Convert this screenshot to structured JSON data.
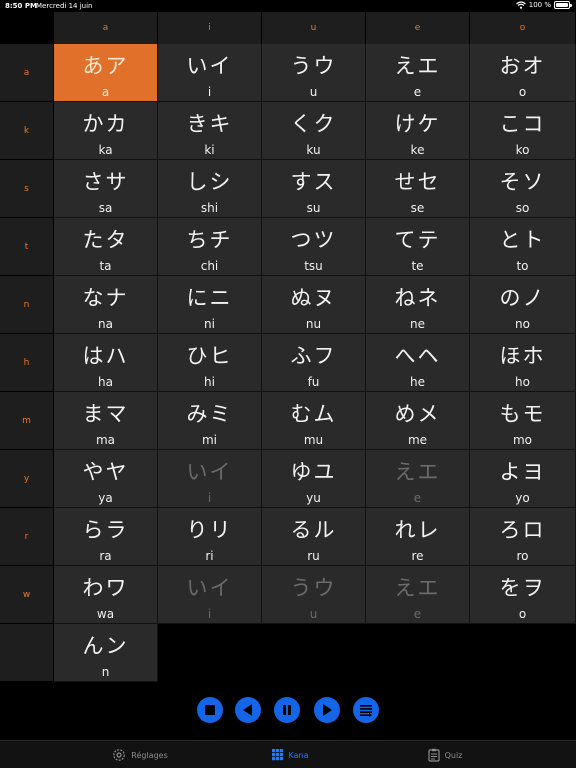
{
  "status": {
    "time": "8:50 PM",
    "date": "Mercredi 14 juin",
    "battery": "100 %"
  },
  "columns": [
    "a",
    "i",
    "u",
    "e",
    "o"
  ],
  "rows": [
    {
      "label": "a",
      "cells": [
        {
          "kana": "あア",
          "romaji": "a",
          "selected": true
        },
        {
          "kana": "いイ",
          "romaji": "i"
        },
        {
          "kana": "うウ",
          "romaji": "u"
        },
        {
          "kana": "えエ",
          "romaji": "e"
        },
        {
          "kana": "おオ",
          "romaji": "o"
        }
      ]
    },
    {
      "label": "k",
      "cells": [
        {
          "kana": "かカ",
          "romaji": "ka"
        },
        {
          "kana": "きキ",
          "romaji": "ki"
        },
        {
          "kana": "くク",
          "romaji": "ku"
        },
        {
          "kana": "けケ",
          "romaji": "ke"
        },
        {
          "kana": "こコ",
          "romaji": "ko"
        }
      ]
    },
    {
      "label": "s",
      "cells": [
        {
          "kana": "さサ",
          "romaji": "sa"
        },
        {
          "kana": "しシ",
          "romaji": "shi"
        },
        {
          "kana": "すス",
          "romaji": "su"
        },
        {
          "kana": "せセ",
          "romaji": "se"
        },
        {
          "kana": "そソ",
          "romaji": "so"
        }
      ]
    },
    {
      "label": "t",
      "cells": [
        {
          "kana": "たタ",
          "romaji": "ta"
        },
        {
          "kana": "ちチ",
          "romaji": "chi"
        },
        {
          "kana": "つツ",
          "romaji": "tsu"
        },
        {
          "kana": "てテ",
          "romaji": "te"
        },
        {
          "kana": "とト",
          "romaji": "to"
        }
      ]
    },
    {
      "label": "n",
      "cells": [
        {
          "kana": "なナ",
          "romaji": "na"
        },
        {
          "kana": "にニ",
          "romaji": "ni"
        },
        {
          "kana": "ぬヌ",
          "romaji": "nu"
        },
        {
          "kana": "ねネ",
          "romaji": "ne"
        },
        {
          "kana": "のノ",
          "romaji": "no"
        }
      ]
    },
    {
      "label": "h",
      "cells": [
        {
          "kana": "はハ",
          "romaji": "ha"
        },
        {
          "kana": "ひヒ",
          "romaji": "hi"
        },
        {
          "kana": "ふフ",
          "romaji": "fu"
        },
        {
          "kana": "へヘ",
          "romaji": "he"
        },
        {
          "kana": "ほホ",
          "romaji": "ho"
        }
      ]
    },
    {
      "label": "m",
      "cells": [
        {
          "kana": "まマ",
          "romaji": "ma"
        },
        {
          "kana": "みミ",
          "romaji": "mi"
        },
        {
          "kana": "むム",
          "romaji": "mu"
        },
        {
          "kana": "めメ",
          "romaji": "me"
        },
        {
          "kana": "もモ",
          "romaji": "mo"
        }
      ]
    },
    {
      "label": "y",
      "cells": [
        {
          "kana": "やヤ",
          "romaji": "ya"
        },
        {
          "kana": "いイ",
          "romaji": "i",
          "dim": true
        },
        {
          "kana": "ゆユ",
          "romaji": "yu"
        },
        {
          "kana": "えエ",
          "romaji": "e",
          "dim": true
        },
        {
          "kana": "よヨ",
          "romaji": "yo"
        }
      ]
    },
    {
      "label": "r",
      "cells": [
        {
          "kana": "らラ",
          "romaji": "ra"
        },
        {
          "kana": "りリ",
          "romaji": "ri"
        },
        {
          "kana": "るル",
          "romaji": "ru"
        },
        {
          "kana": "れレ",
          "romaji": "re"
        },
        {
          "kana": "ろロ",
          "romaji": "ro"
        }
      ]
    },
    {
      "label": "w",
      "cells": [
        {
          "kana": "わワ",
          "romaji": "wa"
        },
        {
          "kana": "いイ",
          "romaji": "i",
          "dim": true
        },
        {
          "kana": "うウ",
          "romaji": "u",
          "dim": true
        },
        {
          "kana": "えエ",
          "romaji": "e",
          "dim": true
        },
        {
          "kana": "をヲ",
          "romaji": "o"
        }
      ]
    },
    {
      "label": "",
      "cells": [
        {
          "kana": "んン",
          "romaji": "n"
        }
      ]
    }
  ],
  "controls": [
    {
      "name": "stop-button",
      "icon": "stop-icon"
    },
    {
      "name": "previous-button",
      "icon": "previous-icon"
    },
    {
      "name": "pause-button",
      "icon": "pause-icon"
    },
    {
      "name": "next-button",
      "icon": "next-icon"
    },
    {
      "name": "list-options-button",
      "icon": "list-icon"
    }
  ],
  "tabs": [
    {
      "label": "Réglages",
      "icon": "gear-icon",
      "active": false
    },
    {
      "label": "Kana",
      "icon": "grid-icon",
      "active": true
    },
    {
      "label": "Quiz",
      "icon": "clipboard-icon",
      "active": false
    }
  ],
  "colors": {
    "accent": "#e0702a",
    "header_text": "#e8782a",
    "control_blue": "#1565e8",
    "tab_active": "#1c7cff"
  }
}
